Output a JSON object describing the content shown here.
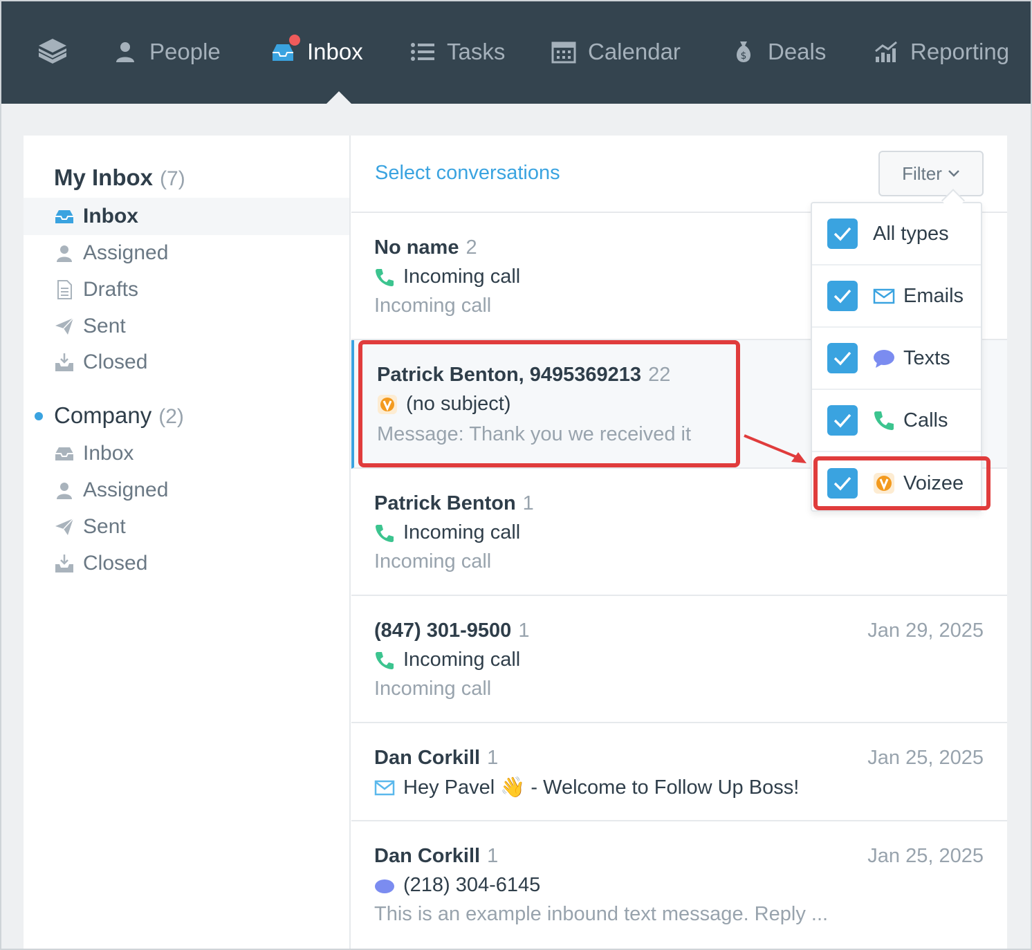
{
  "nav": {
    "items": [
      {
        "label": "People",
        "icon": "person-icon"
      },
      {
        "label": "Inbox",
        "icon": "inbox-icon",
        "active": true,
        "badge": true
      },
      {
        "label": "Tasks",
        "icon": "list-icon"
      },
      {
        "label": "Calendar",
        "icon": "calendar-icon"
      },
      {
        "label": "Deals",
        "icon": "money-bag-icon"
      },
      {
        "label": "Reporting",
        "icon": "chart-icon"
      }
    ]
  },
  "sidebar": {
    "my_inbox": {
      "title": "My Inbox",
      "count": "(7)",
      "items": [
        "Inbox",
        "Assigned",
        "Drafts",
        "Sent",
        "Closed"
      ]
    },
    "company": {
      "title": "Company",
      "count": "(2)",
      "items": [
        "Inbox",
        "Assigned",
        "Sent",
        "Closed"
      ]
    }
  },
  "list": {
    "select_label": "Select conversations",
    "filter_label": "Filter",
    "conversations": [
      {
        "name": "No name",
        "count": "2",
        "date": "",
        "type": "call",
        "subject": "Incoming call",
        "preview": "Incoming call"
      },
      {
        "name": "Patrick Benton, 9495369213",
        "count": "22",
        "date": "",
        "type": "voizee",
        "subject": "(no subject)",
        "preview": "Message: Thank you we received it"
      },
      {
        "name": "Patrick Benton",
        "count": "1",
        "date": "",
        "type": "call",
        "subject": "Incoming call",
        "preview": "Incoming call"
      },
      {
        "name": "(847) 301-9500",
        "count": "1",
        "date": "Jan 29, 2025",
        "type": "call",
        "subject": "Incoming call",
        "preview": "Incoming call"
      },
      {
        "name": "Dan Corkill",
        "count": "1",
        "date": "Jan 25, 2025",
        "type": "email",
        "subject": "Hey Pavel 👋 - Welcome to Follow Up Boss!",
        "preview": ""
      },
      {
        "name": "Dan Corkill",
        "count": "1",
        "date": "Jan 25, 2025",
        "type": "text",
        "subject": "(218) 304-6145",
        "preview": "This is an example inbound text message. Reply ..."
      }
    ]
  },
  "filter_menu": {
    "items": [
      {
        "label": "All types",
        "checked": true
      },
      {
        "label": "Emails",
        "checked": true,
        "icon": "email-icon"
      },
      {
        "label": "Texts",
        "checked": true,
        "icon": "chat-bubble-icon"
      },
      {
        "label": "Calls",
        "checked": true,
        "icon": "phone-icon"
      },
      {
        "label": "Voizee",
        "checked": true,
        "icon": "voizee-icon"
      }
    ]
  },
  "colors": {
    "nav_bg": "#34444f",
    "accent": "#3aa3e0",
    "highlight": "#e03c3c",
    "call_green": "#3cc48f",
    "voizee_orange": "#f39a1e",
    "text_purple": "#7b8cf0"
  }
}
